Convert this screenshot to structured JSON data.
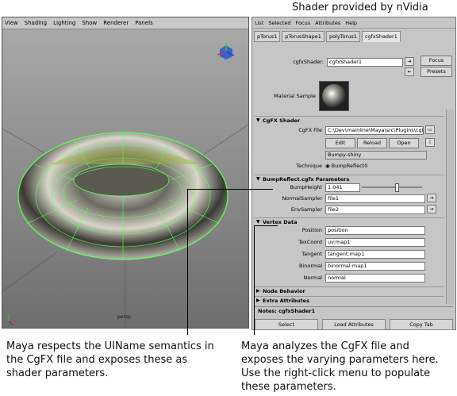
{
  "caption_top": "Shader provided by nVidia",
  "viewport": {
    "menu": [
      "View",
      "Shading",
      "Lighting",
      "Show",
      "Renderer",
      "Panels"
    ],
    "camera_label": "persp"
  },
  "attribute_editor": {
    "menu": [
      "List",
      "Selected",
      "Focus",
      "Attributes",
      "Help"
    ],
    "tabs": [
      "pTorus1",
      "pTorusShape1",
      "polyTorus1",
      "cgfxShader1"
    ],
    "shader_label": "cgfxShader:",
    "shader_value": "cgfxShader1",
    "focus_button": "Focus",
    "presets_button": "Presets",
    "material_sample_label": "Material Sample",
    "cgfx_section": "CgFX Shader",
    "cgfx_file_label": "CgFX File",
    "cgfx_file_value": "C:\\Dev\\mainline\\Maya\\src\\Plugins\\cgFX\\",
    "edit_button": "Edit",
    "reload_button": "Reload",
    "open_button": "Open",
    "description_value": "Bumpy-shiny",
    "technique_label": "Technique",
    "technique_value": "BumpReflect0",
    "params_section": "BumpReflect.cgfx Parameters",
    "params": [
      {
        "label": "BumpHeight",
        "value": "1.041"
      },
      {
        "label": "NormalSampler",
        "value": "file1"
      },
      {
        "label": "EnvSampler",
        "value": "file2"
      }
    ],
    "vertex_section": "Vertex Data",
    "vertex": [
      {
        "label": "Position",
        "value": "position"
      },
      {
        "label": "TexCoord",
        "value": "uv:map1"
      },
      {
        "label": "Tangent",
        "value": "tangent:map1"
      },
      {
        "label": "Binormal",
        "value": "binormal:map1"
      },
      {
        "label": "Normal",
        "value": "normal"
      }
    ],
    "node_behavior_section": "Node Behavior",
    "extra_attributes_section": "Extra Attributes",
    "notes_label": "Notes:  cgfxShader1",
    "select_button": "Select",
    "load_attributes_button": "Load Attributes",
    "copy_tab_button": "Copy Tab",
    "slider_level": 0.55
  },
  "caption_left": [
    "Maya respects the UIName semantics in",
    "the CgFX file and exposes these as",
    "shader parameters."
  ],
  "caption_right": [
    "Maya analyzes the CgFX file and",
    "exposes the varying parameters here.",
    "Use the right-click menu to populate",
    "these parameters."
  ],
  "colors": {
    "wireframe": "#5cff5c",
    "ae_bg": "#c6c6c6",
    "viewport_bg": "#9a9a9a"
  }
}
